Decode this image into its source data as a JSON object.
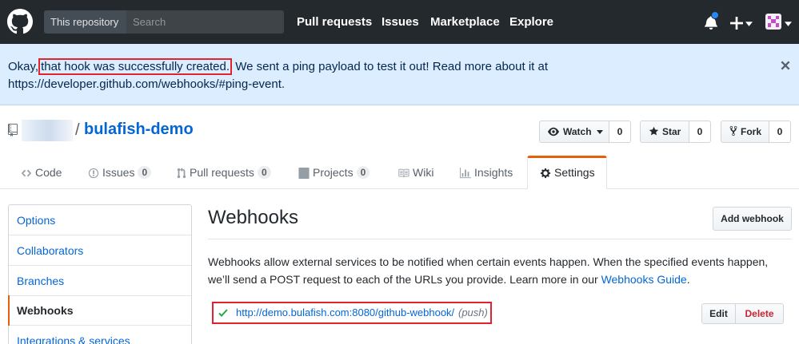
{
  "header": {
    "scope_label": "This repository",
    "search_placeholder": "Search",
    "nav": [
      "Pull requests",
      "Issues",
      "Marketplace",
      "Explore"
    ]
  },
  "flash": {
    "prefix": "Okay,",
    "highlight": "that hook was successfully created.",
    "rest": " We sent a ping payload to test it out! Read more about it at https://developer.github.com/webhooks/#ping-event."
  },
  "repo": {
    "separator": "/",
    "name": "bulafish-demo",
    "watch_label": "Watch",
    "watch_count": "0",
    "star_label": "Star",
    "star_count": "0",
    "fork_label": "Fork",
    "fork_count": "0"
  },
  "tabs": {
    "code": "Code",
    "issues": "Issues",
    "issues_count": "0",
    "pulls": "Pull requests",
    "pulls_count": "0",
    "projects": "Projects",
    "projects_count": "0",
    "wiki": "Wiki",
    "insights": "Insights",
    "settings": "Settings"
  },
  "menu": [
    "Options",
    "Collaborators",
    "Branches",
    "Webhooks",
    "Integrations & services"
  ],
  "main": {
    "title": "Webhooks",
    "add_button": "Add webhook",
    "desc_text": "Webhooks allow external services to be notified when certain events happen. When the specified events happen, we’ll send a POST request to each of the URLs you provide. Learn more in our ",
    "desc_link": "Webhooks Guide",
    "desc_end": ".",
    "hook_url": "http://demo.bulafish.com:8080/github-webhook/",
    "hook_events": "(push)",
    "edit_label": "Edit",
    "delete_label": "Delete"
  },
  "colors": {
    "header_bg": "#24292e",
    "flash_bg": "#dbedff",
    "link": "#0366d6",
    "accent": "#e36209",
    "highlight_box": "#e0232c",
    "success": "#28a745",
    "danger": "#cb2431"
  },
  "icons": [
    "github-logo-icon",
    "bell-icon",
    "plus-icon",
    "avatar",
    "close-icon",
    "repo-icon",
    "eye-icon",
    "star-icon",
    "fork-icon",
    "code-icon",
    "issue-icon",
    "pull-request-icon",
    "project-icon",
    "book-icon",
    "graph-icon",
    "gear-icon",
    "check-icon"
  ]
}
